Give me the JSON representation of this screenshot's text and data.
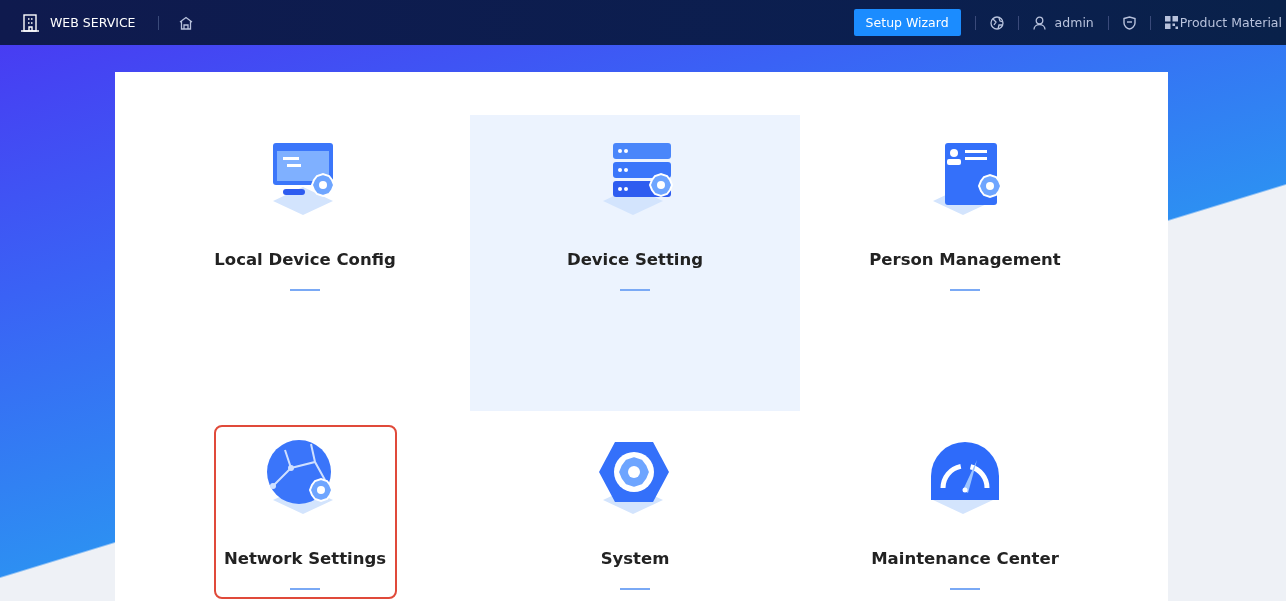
{
  "header": {
    "title": "WEB SERVICE",
    "setup_button": "Setup Wizard",
    "user": "admin",
    "product_link": "Product Material"
  },
  "tiles": [
    {
      "label": "Local Device Config",
      "kind": "monitor",
      "hovered": false,
      "outlined": false
    },
    {
      "label": "Device Setting",
      "kind": "server",
      "hovered": true,
      "outlined": false
    },
    {
      "label": "Person Management",
      "kind": "person",
      "hovered": false,
      "outlined": false
    },
    {
      "label": "Network Settings",
      "kind": "globe",
      "hovered": false,
      "outlined": true
    },
    {
      "label": "System",
      "kind": "hexagon",
      "hovered": false,
      "outlined": false
    },
    {
      "label": "Maintenance Center",
      "kind": "gauge",
      "hovered": false,
      "outlined": false
    }
  ]
}
